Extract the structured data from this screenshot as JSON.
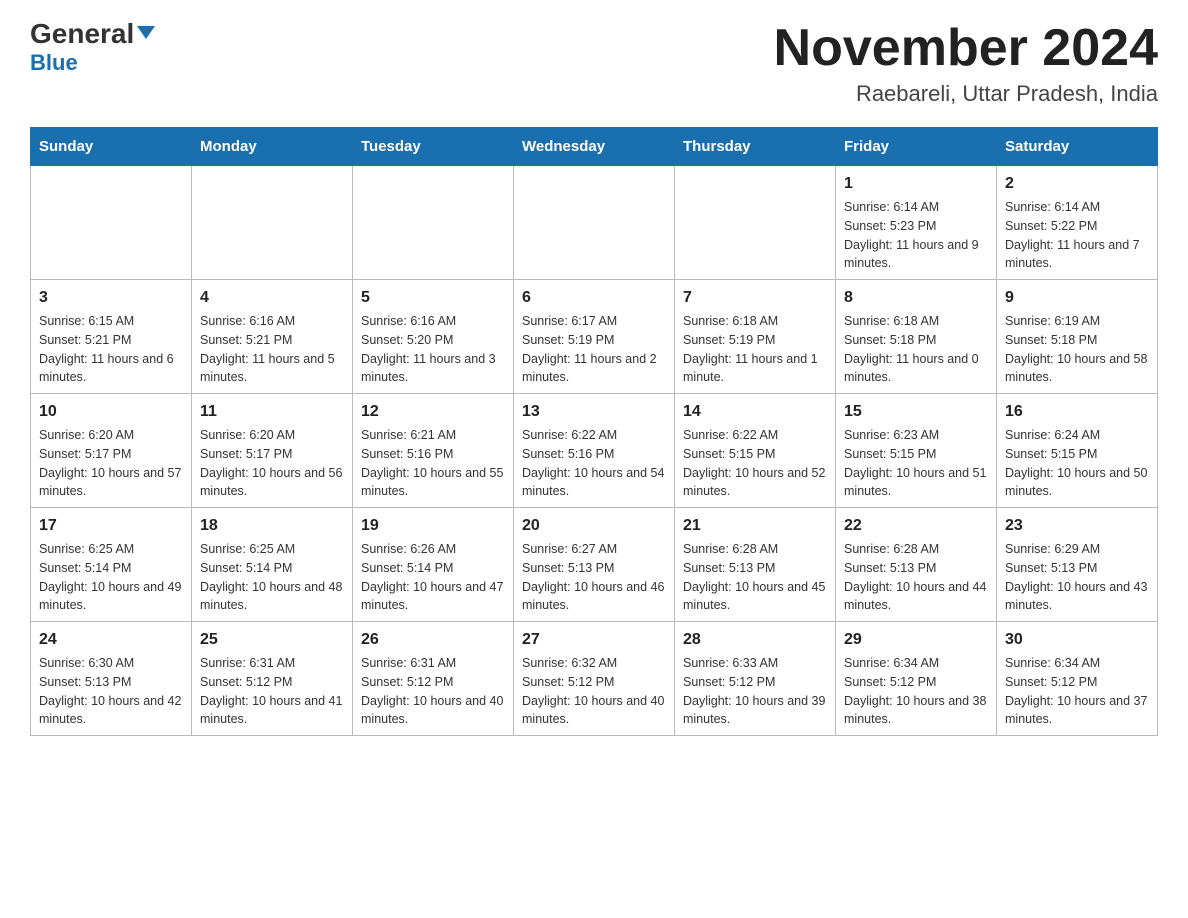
{
  "header": {
    "logo_main": "General",
    "logo_blue": "Blue",
    "month_title": "November 2024",
    "subtitle": "Raebareli, Uttar Pradesh, India"
  },
  "days_of_week": [
    "Sunday",
    "Monday",
    "Tuesday",
    "Wednesday",
    "Thursday",
    "Friday",
    "Saturday"
  ],
  "weeks": [
    [
      {
        "day": "",
        "info": ""
      },
      {
        "day": "",
        "info": ""
      },
      {
        "day": "",
        "info": ""
      },
      {
        "day": "",
        "info": ""
      },
      {
        "day": "",
        "info": ""
      },
      {
        "day": "1",
        "info": "Sunrise: 6:14 AM\nSunset: 5:23 PM\nDaylight: 11 hours and 9 minutes."
      },
      {
        "day": "2",
        "info": "Sunrise: 6:14 AM\nSunset: 5:22 PM\nDaylight: 11 hours and 7 minutes."
      }
    ],
    [
      {
        "day": "3",
        "info": "Sunrise: 6:15 AM\nSunset: 5:21 PM\nDaylight: 11 hours and 6 minutes."
      },
      {
        "day": "4",
        "info": "Sunrise: 6:16 AM\nSunset: 5:21 PM\nDaylight: 11 hours and 5 minutes."
      },
      {
        "day": "5",
        "info": "Sunrise: 6:16 AM\nSunset: 5:20 PM\nDaylight: 11 hours and 3 minutes."
      },
      {
        "day": "6",
        "info": "Sunrise: 6:17 AM\nSunset: 5:19 PM\nDaylight: 11 hours and 2 minutes."
      },
      {
        "day": "7",
        "info": "Sunrise: 6:18 AM\nSunset: 5:19 PM\nDaylight: 11 hours and 1 minute."
      },
      {
        "day": "8",
        "info": "Sunrise: 6:18 AM\nSunset: 5:18 PM\nDaylight: 11 hours and 0 minutes."
      },
      {
        "day": "9",
        "info": "Sunrise: 6:19 AM\nSunset: 5:18 PM\nDaylight: 10 hours and 58 minutes."
      }
    ],
    [
      {
        "day": "10",
        "info": "Sunrise: 6:20 AM\nSunset: 5:17 PM\nDaylight: 10 hours and 57 minutes."
      },
      {
        "day": "11",
        "info": "Sunrise: 6:20 AM\nSunset: 5:17 PM\nDaylight: 10 hours and 56 minutes."
      },
      {
        "day": "12",
        "info": "Sunrise: 6:21 AM\nSunset: 5:16 PM\nDaylight: 10 hours and 55 minutes."
      },
      {
        "day": "13",
        "info": "Sunrise: 6:22 AM\nSunset: 5:16 PM\nDaylight: 10 hours and 54 minutes."
      },
      {
        "day": "14",
        "info": "Sunrise: 6:22 AM\nSunset: 5:15 PM\nDaylight: 10 hours and 52 minutes."
      },
      {
        "day": "15",
        "info": "Sunrise: 6:23 AM\nSunset: 5:15 PM\nDaylight: 10 hours and 51 minutes."
      },
      {
        "day": "16",
        "info": "Sunrise: 6:24 AM\nSunset: 5:15 PM\nDaylight: 10 hours and 50 minutes."
      }
    ],
    [
      {
        "day": "17",
        "info": "Sunrise: 6:25 AM\nSunset: 5:14 PM\nDaylight: 10 hours and 49 minutes."
      },
      {
        "day": "18",
        "info": "Sunrise: 6:25 AM\nSunset: 5:14 PM\nDaylight: 10 hours and 48 minutes."
      },
      {
        "day": "19",
        "info": "Sunrise: 6:26 AM\nSunset: 5:14 PM\nDaylight: 10 hours and 47 minutes."
      },
      {
        "day": "20",
        "info": "Sunrise: 6:27 AM\nSunset: 5:13 PM\nDaylight: 10 hours and 46 minutes."
      },
      {
        "day": "21",
        "info": "Sunrise: 6:28 AM\nSunset: 5:13 PM\nDaylight: 10 hours and 45 minutes."
      },
      {
        "day": "22",
        "info": "Sunrise: 6:28 AM\nSunset: 5:13 PM\nDaylight: 10 hours and 44 minutes."
      },
      {
        "day": "23",
        "info": "Sunrise: 6:29 AM\nSunset: 5:13 PM\nDaylight: 10 hours and 43 minutes."
      }
    ],
    [
      {
        "day": "24",
        "info": "Sunrise: 6:30 AM\nSunset: 5:13 PM\nDaylight: 10 hours and 42 minutes."
      },
      {
        "day": "25",
        "info": "Sunrise: 6:31 AM\nSunset: 5:12 PM\nDaylight: 10 hours and 41 minutes."
      },
      {
        "day": "26",
        "info": "Sunrise: 6:31 AM\nSunset: 5:12 PM\nDaylight: 10 hours and 40 minutes."
      },
      {
        "day": "27",
        "info": "Sunrise: 6:32 AM\nSunset: 5:12 PM\nDaylight: 10 hours and 40 minutes."
      },
      {
        "day": "28",
        "info": "Sunrise: 6:33 AM\nSunset: 5:12 PM\nDaylight: 10 hours and 39 minutes."
      },
      {
        "day": "29",
        "info": "Sunrise: 6:34 AM\nSunset: 5:12 PM\nDaylight: 10 hours and 38 minutes."
      },
      {
        "day": "30",
        "info": "Sunrise: 6:34 AM\nSunset: 5:12 PM\nDaylight: 10 hours and 37 minutes."
      }
    ]
  ]
}
